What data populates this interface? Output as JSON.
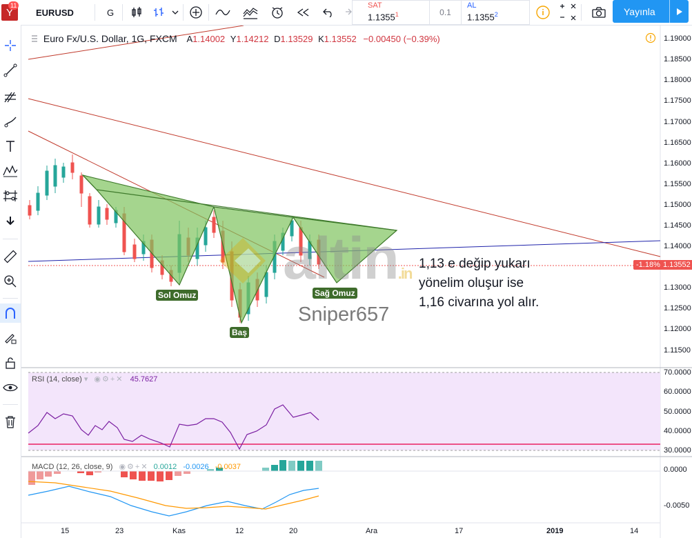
{
  "toolbar": {
    "avatar_letter": "Y",
    "notification_count": "11",
    "symbol": "EURUSD",
    "interval": "G",
    "publish_label": "Yayınla"
  },
  "trade": {
    "sell_label": "SAT",
    "sell_price": "1.1355",
    "sell_sup": "1",
    "spread": "0.1",
    "buy_label": "AL",
    "buy_price": "1.1355",
    "buy_sup": "2"
  },
  "legend": {
    "title": "Euro Fx/U.S. Dollar, 1G, FXCM",
    "o_key": "A",
    "o_val": "1.14002",
    "h_key": "Y",
    "h_val": "1.14212",
    "l_key": "D",
    "l_val": "1.13529",
    "c_key": "K",
    "c_val": "1.13552",
    "change": "−0.00450 (−0.39%)"
  },
  "price_axis": {
    "labels": [
      "1.19000",
      "1.18500",
      "1.18000",
      "1.17500",
      "1.17000",
      "1.16500",
      "1.16000",
      "1.15500",
      "1.15000",
      "1.14500",
      "1.14000",
      "1.13500",
      "1.13000",
      "1.12500",
      "1.12000",
      "1.11500"
    ],
    "last_change": "-1.18%",
    "last_price": "1.13552"
  },
  "time_axis": {
    "labels": [
      "15",
      "23",
      "Kas",
      "12",
      "20",
      "Ara",
      "17",
      "2019",
      "14"
    ]
  },
  "annotations": {
    "left_shoulder": "Sol Omuz",
    "head": "Baş",
    "right_shoulder": "Sağ Omuz",
    "note_line1": "1,13 e değip yukarı",
    "note_line2": "yönelim oluşur ise",
    "note_line3": "1,16 civarına yol alır.",
    "watermark": "altin",
    "watermark_suffix": ".in",
    "author": "Sniper657"
  },
  "rsi": {
    "label": "RSI (14, close)",
    "value": "45.7627",
    "axis": [
      "70.0000",
      "60.0000",
      "50.0000",
      "40.0000",
      "30.0000"
    ]
  },
  "macd": {
    "label": "MACD (12, 26, close, 9)",
    "val1": "0.0012",
    "val2": "-0.0026",
    "val3": "-0.0037",
    "axis": [
      "0.0000",
      "-0.0050"
    ]
  },
  "colors": {
    "up": "#26a69a",
    "down": "#ef5350",
    "pattern_fill": "#8fce73",
    "trend": "#c0392b",
    "blue": "#1e22aa",
    "publish": "#2196f3"
  }
}
